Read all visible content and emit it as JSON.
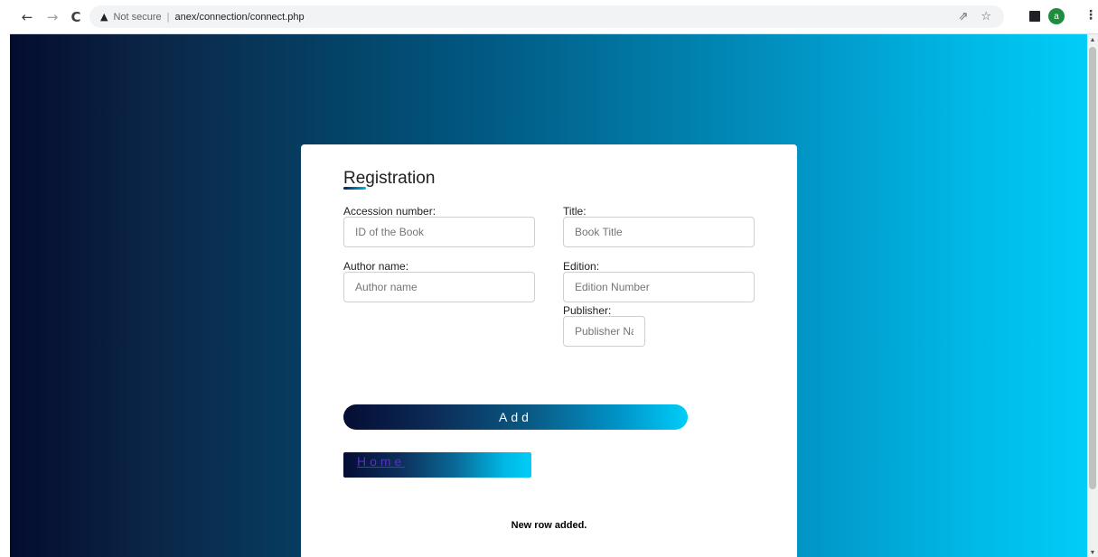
{
  "browser": {
    "security_label": "Not secure",
    "separator": "|",
    "url": "anex/connection/connect.php",
    "profile_initial": "a"
  },
  "form": {
    "title": "Registration",
    "fields": {
      "accession": {
        "label": "Accession number:",
        "placeholder": "ID of the Book"
      },
      "title": {
        "label": "Title:",
        "placeholder": "Book Title"
      },
      "author": {
        "label": "Author name:",
        "placeholder": "Author name"
      },
      "edition": {
        "label": "Edition:",
        "placeholder": "Edition Number"
      },
      "publisher": {
        "label": "Publisher:",
        "placeholder": "Publisher Name"
      }
    },
    "add_label": "Add",
    "home_label": "Home",
    "status": "New row added."
  },
  "colors": {
    "gradient_dark": "#040c2e",
    "gradient_light": "#00cdf8",
    "home_link": "#5a2ec2",
    "card_bg": "#ffffff"
  }
}
